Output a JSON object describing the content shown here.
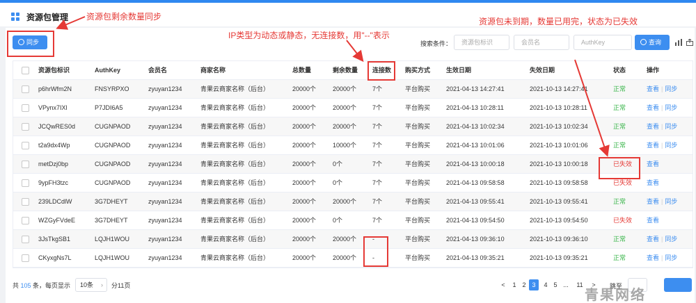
{
  "header": {
    "title": "资源包管理"
  },
  "toolbar": {
    "sync_label": "同步",
    "search_label": "搜索条件：",
    "search_fields": [
      {
        "placeholder": "资源包标识"
      },
      {
        "placeholder": "会员名"
      },
      {
        "placeholder": "AuthKey"
      }
    ],
    "query_label": "查询"
  },
  "table": {
    "headers": [
      "资源包标识",
      "AuthKey",
      "会员名",
      "商家名称",
      "总数量",
      "剩余数量",
      "连接数",
      "购买方式",
      "生效日期",
      "失效日期",
      "状态",
      "操作"
    ],
    "rows": [
      {
        "id": "p6hrWfm2N",
        "authkey": "FNSYRPXO",
        "member": "zyuyan1234",
        "merchant": "青果云商家名称（后台）",
        "total": "20000个",
        "remaining": "20000个",
        "connections": "7个",
        "purchase": "平台购买",
        "start": "2021-04-13 14:27:41",
        "end": "2021-10-13 14:27:41",
        "status": "正常",
        "status_ok": true,
        "ops": [
          "查看",
          "同步"
        ]
      },
      {
        "id": "VPynx7IXl",
        "authkey": "P7JDI6A5",
        "member": "zyuyan1234",
        "merchant": "青果云商家名称（后台）",
        "total": "20000个",
        "remaining": "20000个",
        "connections": "7个",
        "purchase": "平台购买",
        "start": "2021-04-13 10:28:11",
        "end": "2021-10-13 10:28:11",
        "status": "正常",
        "status_ok": true,
        "ops": [
          "查看",
          "同步"
        ]
      },
      {
        "id": "JCQwRES0d",
        "authkey": "CUGNPAOD",
        "member": "zyuyan1234",
        "merchant": "青果云商家名称（后台）",
        "total": "20000个",
        "remaining": "20000个",
        "connections": "7个",
        "purchase": "平台购买",
        "start": "2021-04-13 10:02:34",
        "end": "2021-10-13 10:02:34",
        "status": "正常",
        "status_ok": true,
        "ops": [
          "查看",
          "同步"
        ]
      },
      {
        "id": "t2a9dx4Wp",
        "authkey": "CUGNPAOD",
        "member": "zyuyan1234",
        "merchant": "青果云商家名称（后台）",
        "total": "20000个",
        "remaining": "10000个",
        "connections": "7个",
        "purchase": "平台购买",
        "start": "2021-04-13 10:01:06",
        "end": "2021-10-13 10:01:06",
        "status": "正常",
        "status_ok": true,
        "ops": [
          "查看",
          "同步"
        ]
      },
      {
        "id": "metDzj0bp",
        "authkey": "CUGNPAOD",
        "member": "zyuyan1234",
        "merchant": "青果云商家名称（后台）",
        "total": "20000个",
        "remaining": "0个",
        "connections": "7个",
        "purchase": "平台购买",
        "start": "2021-04-13 10:00:18",
        "end": "2021-10-13 10:00:18",
        "status": "已失效",
        "status_ok": false,
        "ops": [
          "查看"
        ]
      },
      {
        "id": "9ypFH3tzc",
        "authkey": "CUGNPAOD",
        "member": "zyuyan1234",
        "merchant": "青果云商家名称（后台）",
        "total": "20000个",
        "remaining": "0个",
        "connections": "7个",
        "purchase": "平台购买",
        "start": "2021-04-13 09:58:58",
        "end": "2021-10-13 09:58:58",
        "status": "已失效",
        "status_ok": false,
        "ops": [
          "查看"
        ]
      },
      {
        "id": "239LDCdlW",
        "authkey": "3G7DHEYT",
        "member": "zyuyan1234",
        "merchant": "青果云商家名称（后台）",
        "total": "20000个",
        "remaining": "20000个",
        "connections": "7个",
        "purchase": "平台购买",
        "start": "2021-04-13 09:55:41",
        "end": "2021-10-13 09:55:41",
        "status": "正常",
        "status_ok": true,
        "ops": [
          "查看",
          "同步"
        ]
      },
      {
        "id": "WZGyFVdeE",
        "authkey": "3G7DHEYT",
        "member": "zyuyan1234",
        "merchant": "青果云商家名称（后台）",
        "total": "20000个",
        "remaining": "0个",
        "connections": "7个",
        "purchase": "平台购买",
        "start": "2021-04-13 09:54:50",
        "end": "2021-10-13 09:54:50",
        "status": "已失效",
        "status_ok": false,
        "ops": [
          "查看"
        ]
      },
      {
        "id": "3JsTkgSB1",
        "authkey": "LQJH1WOU",
        "member": "zyuyan1234",
        "merchant": "青果云商家名称（后台）",
        "total": "20000个",
        "remaining": "20000个",
        "connections": "-",
        "purchase": "平台购买",
        "start": "2021-04-13 09:36:10",
        "end": "2021-10-13 09:36:10",
        "status": "正常",
        "status_ok": true,
        "ops": [
          "查看",
          "同步"
        ]
      },
      {
        "id": "CKyxgNs7L",
        "authkey": "LQJH1WOU",
        "member": "zyuyan1234",
        "merchant": "青果云商家名称（后台）",
        "total": "20000个",
        "remaining": "20000个",
        "connections": "-",
        "purchase": "平台购买",
        "start": "2021-04-13 09:35:21",
        "end": "2021-10-13 09:35:21",
        "status": "正常",
        "status_ok": true,
        "ops": [
          "查看",
          "同步"
        ]
      }
    ]
  },
  "pagination": {
    "total_prefix": "共 ",
    "total": "105",
    "total_suffix": " 条，每页显示",
    "page_size": "10条",
    "total_pages": "分11页",
    "pages": [
      "<",
      "1",
      "2",
      "3",
      "4",
      "5",
      "...",
      "11",
      ">"
    ],
    "current": "3",
    "jump_label": "跳至"
  },
  "annotations": {
    "sync_note": "资源包剩余数量同步",
    "ip_note": "IP类型为动态或静态，无连接数，用\"--\"表示",
    "expired_note": "资源包未到期，数量已用完，状态为已失效"
  },
  "watermark": "青果网络",
  "colors": {
    "accent": "#3d8ef0",
    "ok": "#39b54a",
    "bad": "#e53935"
  }
}
